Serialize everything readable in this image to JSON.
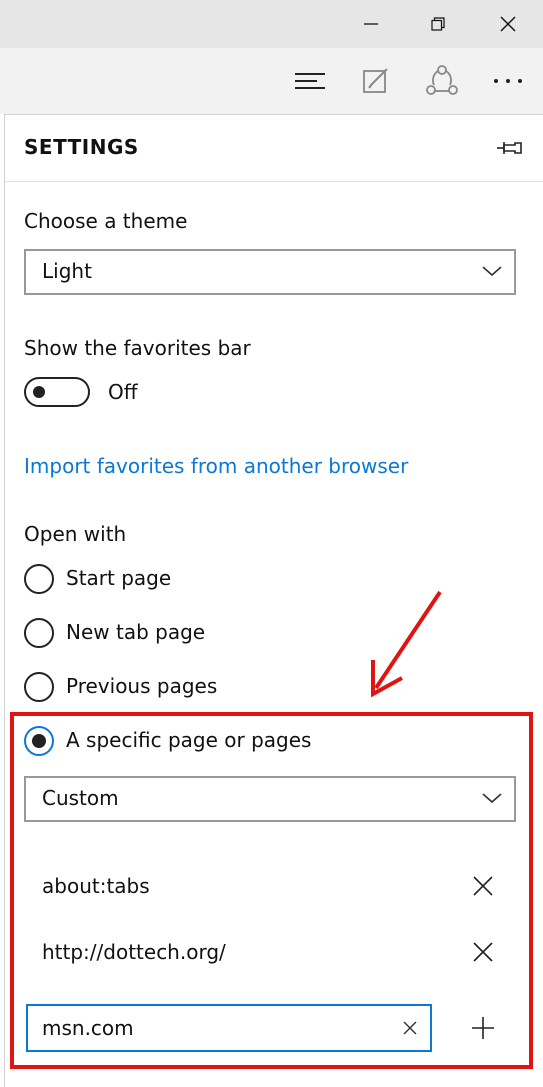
{
  "window": {
    "controls": [
      "minimize",
      "restore",
      "close"
    ]
  },
  "toolbar": {
    "icons": [
      "hub-icon",
      "web-note-icon",
      "share-icon",
      "more-icon"
    ]
  },
  "panel": {
    "title": "SETTINGS",
    "theme": {
      "label": "Choose a theme",
      "value": "Light"
    },
    "favorites_bar": {
      "label": "Show the favorites bar",
      "state": "Off"
    },
    "import_link": "Import favorites from another browser",
    "open_with": {
      "label": "Open with",
      "options": [
        "Start page",
        "New tab page",
        "Previous pages",
        "A specific page or pages"
      ],
      "selected": "A specific page or pages",
      "pages_dropdown": "Custom",
      "pages": [
        "about:tabs",
        "http://dottech.org/"
      ],
      "new_page_value": "msn.com"
    }
  },
  "colors": {
    "accent": "#0b78d6",
    "highlight": "#e11414"
  }
}
